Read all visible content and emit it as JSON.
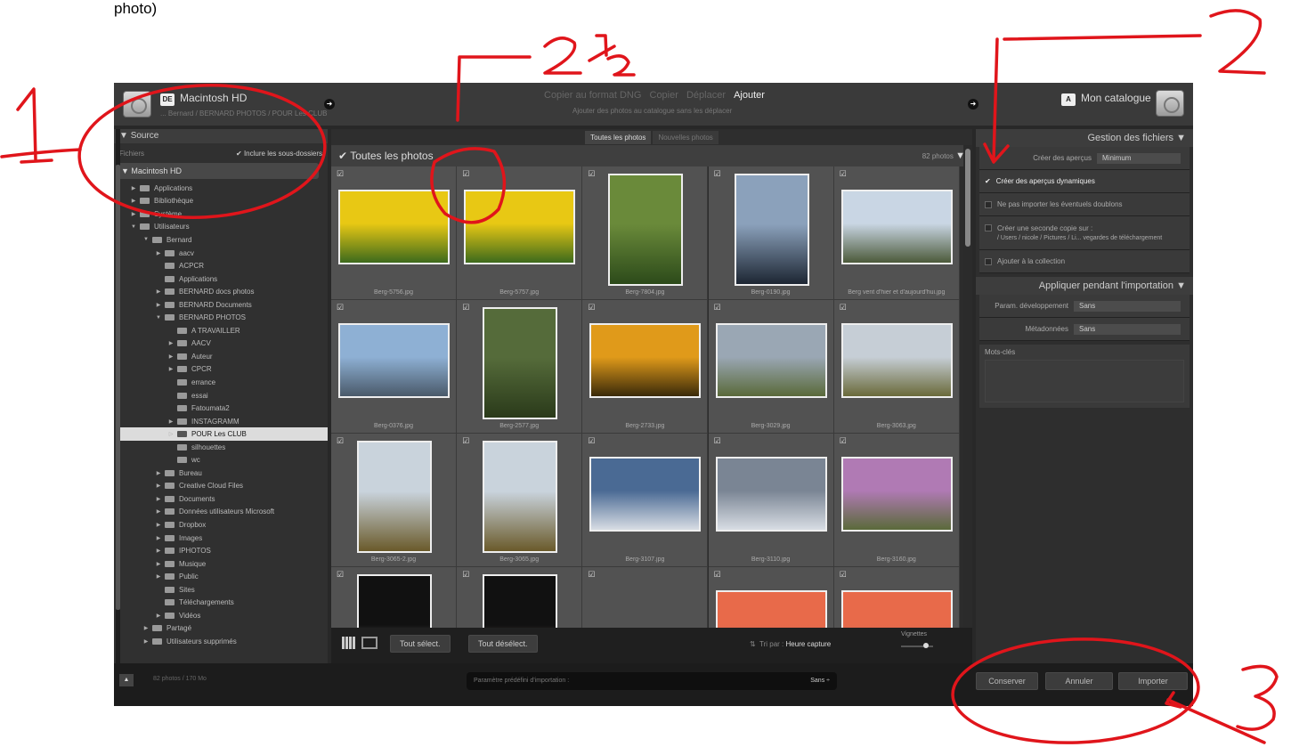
{
  "caption": "photo)",
  "header": {
    "source_badge": "DE",
    "source_title": "Macintosh HD",
    "source_path": "... Bernard / BERNARD PHOTOS / POUR Les CLUB",
    "modes": [
      "Copier au format DNG",
      "Copier",
      "Déplacer",
      "Ajouter"
    ],
    "active_mode": "Ajouter",
    "mode_description": "Ajouter des photos au catalogue sans les déplacer",
    "dest_badge": "A",
    "dest_title": "Mon catalogue"
  },
  "left_panel": {
    "title": "Source",
    "files_label": "Fichiers",
    "include_subfolders": "Inclure les sous-dossiers",
    "volume": "Macintosh HD",
    "tree": [
      {
        "label": "Applications",
        "level": 0,
        "expander": "▶"
      },
      {
        "label": "Bibliothèque",
        "level": 0,
        "expander": "▶"
      },
      {
        "label": "Système",
        "level": 0,
        "expander": "▶"
      },
      {
        "label": "Utilisateurs",
        "level": 0,
        "expander": "▼"
      },
      {
        "label": "Bernard",
        "level": 1,
        "expander": "▼"
      },
      {
        "label": "aacv",
        "level": 2,
        "expander": "▶"
      },
      {
        "label": "ACPCR",
        "level": 2,
        "expander": ""
      },
      {
        "label": "Applications",
        "level": 2,
        "expander": ""
      },
      {
        "label": "BERNARD docs photos",
        "level": 2,
        "expander": "▶"
      },
      {
        "label": "BERNARD Documents",
        "level": 2,
        "expander": "▶"
      },
      {
        "label": "BERNARD PHOTOS",
        "level": 2,
        "expander": "▼"
      },
      {
        "label": "A TRAVAILLER",
        "level": 3,
        "expander": ""
      },
      {
        "label": "AACV",
        "level": 3,
        "expander": "▶"
      },
      {
        "label": "Auteur",
        "level": 3,
        "expander": "▶"
      },
      {
        "label": "CPCR",
        "level": 3,
        "expander": "▶"
      },
      {
        "label": "errance",
        "level": 3,
        "expander": ""
      },
      {
        "label": "essai",
        "level": 3,
        "expander": ""
      },
      {
        "label": "Fatoumata2",
        "level": 3,
        "expander": ""
      },
      {
        "label": "INSTAGRAMM",
        "level": 3,
        "expander": "▶"
      },
      {
        "label": "POUR Les CLUB",
        "level": 3,
        "expander": "▷",
        "selected": true
      },
      {
        "label": "silhouettes",
        "level": 3,
        "expander": ""
      },
      {
        "label": "wc",
        "level": 3,
        "expander": ""
      },
      {
        "label": "Bureau",
        "level": 2,
        "expander": "▶"
      },
      {
        "label": "Creative Cloud Files",
        "level": 2,
        "expander": "▶"
      },
      {
        "label": "Documents",
        "level": 2,
        "expander": "▶"
      },
      {
        "label": "Données utilisateurs Microsoft",
        "level": 2,
        "expander": "▶"
      },
      {
        "label": "Dropbox",
        "level": 2,
        "expander": "▶"
      },
      {
        "label": "Images",
        "level": 2,
        "expander": "▶"
      },
      {
        "label": "IPHOTOS",
        "level": 2,
        "expander": "▶"
      },
      {
        "label": "Musique",
        "level": 2,
        "expander": "▶"
      },
      {
        "label": "Public",
        "level": 2,
        "expander": "▶"
      },
      {
        "label": "Sites",
        "level": 2,
        "expander": ""
      },
      {
        "label": "Téléchargements",
        "level": 2,
        "expander": ""
      },
      {
        "label": "Vidéos",
        "level": 2,
        "expander": "▶"
      },
      {
        "label": "Partagé",
        "level": 1,
        "expander": "▶"
      },
      {
        "label": "Utilisateurs supprimés",
        "level": 1,
        "expander": "▶"
      }
    ]
  },
  "center": {
    "tabs": [
      "Toutes les photos",
      "Nouvelles photos"
    ],
    "active_tab": "Toutes les photos",
    "grid_title": "Toutes les photos",
    "photo_count": "82 photos",
    "photos": [
      {
        "name": "Berg-5756.jpg",
        "orientation": "landscape",
        "colors": [
          "#e8c814",
          "#3d6a1c"
        ]
      },
      {
        "name": "Berg-5757.jpg",
        "orientation": "landscape",
        "colors": [
          "#e8c814",
          "#3d6a1c"
        ]
      },
      {
        "name": "Berg-7804.jpg",
        "orientation": "portrait",
        "colors": [
          "#6a8a3a",
          "#2c4a1a"
        ]
      },
      {
        "name": "Berg-0190.jpg",
        "orientation": "portrait",
        "colors": [
          "#8ba1bb",
          "#1d2633"
        ]
      },
      {
        "name": "Berg vent d'hier et d'aujourd'hui.jpg",
        "orientation": "landscape",
        "colors": [
          "#c9d6e4",
          "#4c5a3a"
        ]
      },
      {
        "name": "Berg-0376.jpg",
        "orientation": "landscape",
        "colors": [
          "#8eb0d4",
          "#4a5a6a"
        ]
      },
      {
        "name": "Berg-2577.jpg",
        "orientation": "portrait",
        "colors": [
          "#556b3a",
          "#2a3a1a"
        ]
      },
      {
        "name": "Berg-2733.jpg",
        "orientation": "landscape",
        "colors": [
          "#e09a1a",
          "#3a2a0a"
        ]
      },
      {
        "name": "Berg-3029.jpg",
        "orientation": "landscape",
        "colors": [
          "#9aa7b4",
          "#5a6a3a"
        ]
      },
      {
        "name": "Berg-3063.jpg",
        "orientation": "landscape",
        "colors": [
          "#c6ced6",
          "#6a6a3a"
        ]
      },
      {
        "name": "Berg-3065-2.jpg",
        "orientation": "portrait",
        "colors": [
          "#c9d3dc",
          "#6a5a2a"
        ]
      },
      {
        "name": "Berg-3065.jpg",
        "orientation": "portrait",
        "colors": [
          "#c9d3dc",
          "#6a5a2a"
        ]
      },
      {
        "name": "Berg-3107.jpg",
        "orientation": "landscape",
        "colors": [
          "#4a6a94",
          "#d8dde4"
        ]
      },
      {
        "name": "Berg-3110.jpg",
        "orientation": "landscape",
        "colors": [
          "#7a8594",
          "#d8dde4"
        ]
      },
      {
        "name": "Berg-3160.jpg",
        "orientation": "landscape",
        "colors": [
          "#b07ab4",
          "#5a6a3a"
        ]
      },
      {
        "name": "",
        "orientation": "portrait",
        "colors": [
          "#111111",
          "#dddddd"
        ]
      },
      {
        "name": "",
        "orientation": "portrait",
        "colors": [
          "#111111",
          "#c49078"
        ]
      },
      {
        "name": "",
        "orientation": "none",
        "colors": [
          "#525252",
          "#525252"
        ]
      },
      {
        "name": "",
        "orientation": "landscape",
        "colors": [
          "#e86a4a",
          "#b85a5a"
        ]
      },
      {
        "name": "",
        "orientation": "landscape",
        "colors": [
          "#e86a4a",
          "#b85a5a"
        ]
      }
    ],
    "toolbar": {
      "select_all": "Tout sélect.",
      "deselect_all": "Tout désélect.",
      "sort_label": "Tri par :",
      "sort_value": "Heure capture",
      "thumbnails_label": "Vignettes"
    }
  },
  "right_panel": {
    "file_handling_title": "Gestion des fichiers",
    "previews_label": "Créer des aperçus",
    "previews_value": "Minimum",
    "smart_previews": "Créer des aperçus dynamiques",
    "no_duplicates": "Ne pas importer les éventuels doublons",
    "second_copy": "Créer une seconde copie sur :",
    "second_copy_path": "/ Users / nicole / Pictures / Li... vegardes de téléchargement",
    "add_collection": "Ajouter à la collection",
    "apply_title": "Appliquer pendant l'importation",
    "develop_label": "Param. développement",
    "develop_value": "Sans",
    "metadata_label": "Métadonnées",
    "metadata_value": "Sans",
    "keywords_label": "Mots-clés"
  },
  "bottom": {
    "info": "82 photos / 170 Mo",
    "preset_label": "Paramètre prédéfini d'importation :",
    "preset_value": "Sans ÷",
    "keep": "Conserver",
    "cancel": "Annuler",
    "import": "Importer"
  },
  "annotations": {
    "label_1": "1",
    "label_2": "2",
    "label_2_half": "2 ½",
    "label_3": "3",
    "ink_color": "#e0151b"
  }
}
